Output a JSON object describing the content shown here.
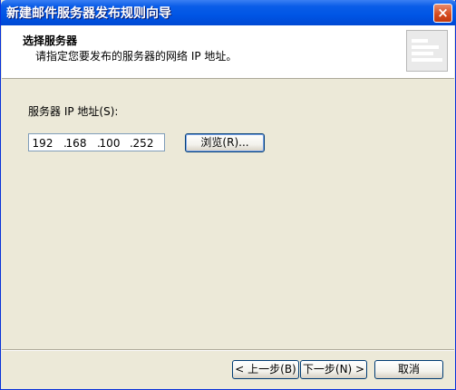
{
  "window": {
    "title": "新建邮件服务器发布规则向导",
    "close_glyph": "×"
  },
  "header": {
    "title": "选择服务器",
    "subtitle": "请指定您要发布的服务器的网络 IP 地址。"
  },
  "form": {
    "ip_label": "服务器 IP 地址(S):",
    "ip_octets": [
      "192",
      "168",
      "100",
      "252"
    ],
    "browse_label": "浏览(R)..."
  },
  "footer": {
    "back_label": "< 上一步(B)",
    "next_label": "下一步(N) >",
    "cancel_label": "取消"
  }
}
